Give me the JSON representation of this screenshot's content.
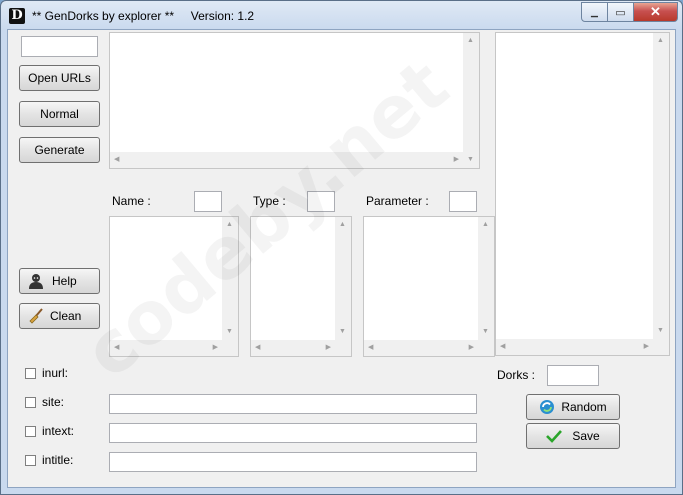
{
  "window": {
    "app_icon_letter": "D",
    "title": "** GenDorks by explorer **     Version: 1.2",
    "minimize_glyph": "▁",
    "maximize_glyph": "▭",
    "close_glyph": "✕"
  },
  "buttons": {
    "open_urls": "Open URLs",
    "normal": "Normal",
    "generate": "Generate",
    "help": "Help",
    "clean": "Clean",
    "random": "Random",
    "save": "Save"
  },
  "labels": {
    "name": "Name :",
    "type": "Type :",
    "parameter": "Parameter :",
    "dorks": "Dorks :"
  },
  "checkboxes": {
    "inurl": "inurl:",
    "site": "site:",
    "intext": "intext:",
    "intitle": "intitle:"
  },
  "inputs": {
    "top_left": "",
    "name": "",
    "type": "",
    "parameter": "",
    "dorks": "",
    "site": "",
    "intext": "",
    "intitle": ""
  },
  "watermark": "codeby.net",
  "colors": {
    "close_button": "#c75050",
    "random_icon": "#2a8fd0",
    "save_check": "#2aa52a"
  }
}
